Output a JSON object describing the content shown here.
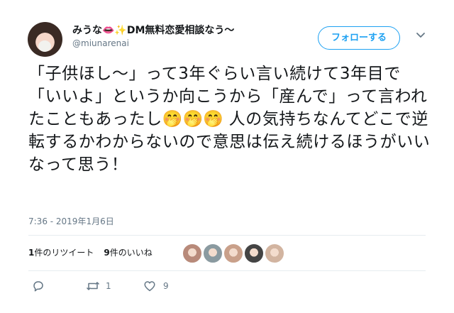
{
  "user": {
    "display_name": "みうな",
    "name_emoji": "👄✨",
    "name_suffix": "DM無料恋愛相談なう〜",
    "handle": "@miunarenai"
  },
  "follow_button": {
    "label": "フォローする"
  },
  "tweet": {
    "text_before": "「子供ほし〜」って3年ぐらい言い続けて3年目で「いいよ」というか向こうから「産んで」って言われたこともあったし",
    "emojis": "🤭🤭🤭",
    "text_after": " 人の気持ちなんてどこで逆転するかわからないので意思は伝え続けるほうがいいなって思う！"
  },
  "timestamp": "7:36 - 2019年1月6日",
  "stats": {
    "retweet_count": "1",
    "retweet_label": "件のリツイート",
    "like_count": "9",
    "like_label": "件のいいね"
  },
  "likers": [
    {
      "color": "#b88a7a"
    },
    {
      "color": "#8a9aa0"
    },
    {
      "color": "#c9a08a"
    },
    {
      "color": "#444444"
    },
    {
      "color": "#d2b4a0"
    }
  ],
  "actions": {
    "reply_count": "",
    "retweet_count": "1",
    "like_count": "9"
  },
  "colors": {
    "accent": "#1da1f2",
    "muted": "#657786"
  }
}
